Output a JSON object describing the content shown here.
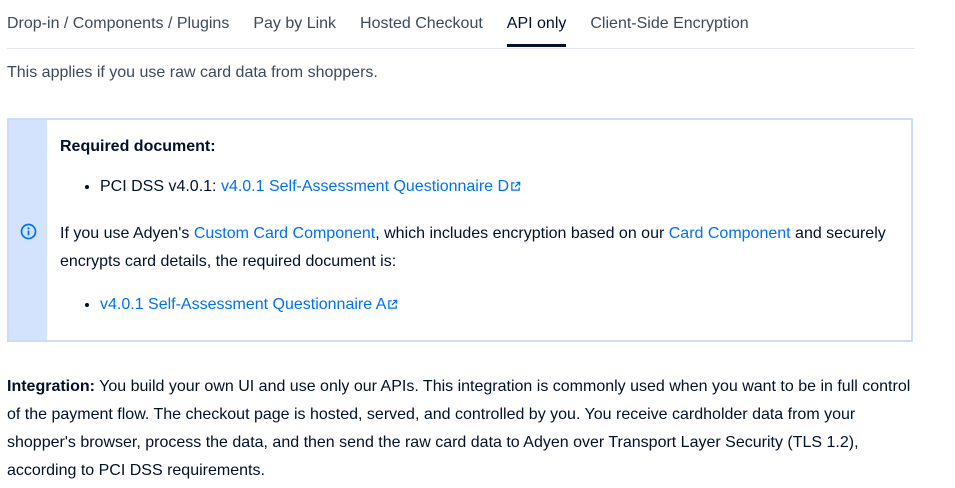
{
  "tabs": [
    {
      "label": "Drop-in / Components / Plugins",
      "active": false
    },
    {
      "label": "Pay by Link",
      "active": false
    },
    {
      "label": "Hosted Checkout",
      "active": false
    },
    {
      "label": "API only",
      "active": true
    },
    {
      "label": "Client-Side Encryption",
      "active": false
    }
  ],
  "intro": "This applies if you use raw card data from shoppers.",
  "callout": {
    "icon": "info-icon",
    "heading": "Required document:",
    "item1_prefix": "PCI DSS v4.0.1: ",
    "item1_link": "v4.0.1 Self-Assessment Questionnaire D",
    "para_before_link1": "If you use Adyen's ",
    "para_link1": "Custom Card Component",
    "para_between": ", which includes encryption based on our ",
    "para_link2": "Card Component",
    "para_after": " and securely encrypts card details, the required document is:",
    "item2_link": "v4.0.1 Self-Assessment Questionnaire A"
  },
  "integration": {
    "label": "Integration:",
    "text": " You build your own UI and use only our APIs. This integration is commonly used when you want to be in full control of the payment flow. The checkout page is hosted, served, and controlled by you. You receive cardholder data from your shopper's browser, process the data, and then send the raw card data to Adyen over Transport Layer Security (TLS 1.2), according to PCI DSS requirements."
  },
  "colors": {
    "link": "#0070f5",
    "callout_bar": "#d3e3fd",
    "callout_border": "#c9dcfb",
    "text": "#00112c"
  }
}
